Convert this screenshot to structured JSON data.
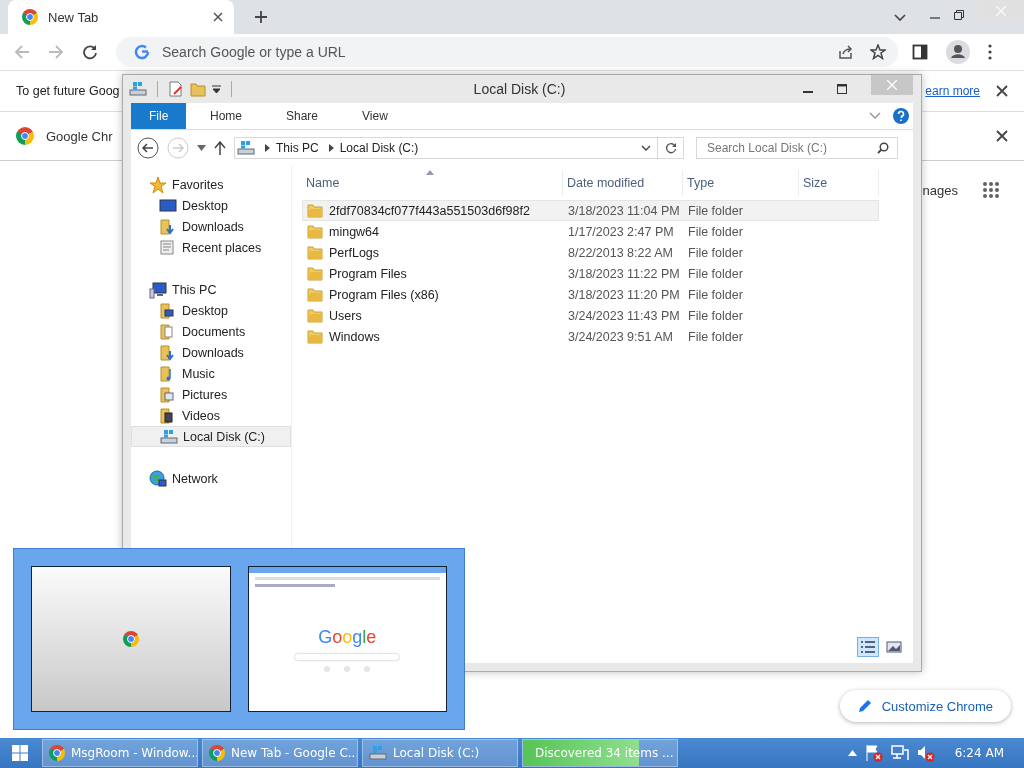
{
  "browser": {
    "tab": {
      "title": "New Tab"
    },
    "omnibox": {
      "placeholder": "Search Google or type a URL"
    },
    "infobar": {
      "text": "To get future Goog",
      "link": "earn more"
    },
    "promo": {
      "text": "Google Chr"
    },
    "ntp_link": "nages",
    "customize_button": "Customize Chrome"
  },
  "explorer": {
    "title": "Local Disk (C:)",
    "ribbon_tabs": [
      {
        "label": "File",
        "kind": "backstage"
      },
      {
        "label": "Home",
        "kind": "tab"
      },
      {
        "label": "Share",
        "kind": "tab"
      },
      {
        "label": "View",
        "kind": "tab"
      }
    ],
    "breadcrumb": [
      "This PC",
      "Local Disk (C:)"
    ],
    "search": {
      "placeholder": "Search Local Disk (C:)"
    },
    "nav": [
      {
        "label": "Favorites",
        "kind": "star",
        "selected": false,
        "children": [
          {
            "label": "Desktop",
            "kind": "desktop",
            "selected": false
          },
          {
            "label": "Downloads",
            "kind": "downloads",
            "selected": false
          },
          {
            "label": "Recent places",
            "kind": "recent",
            "selected": false
          }
        ]
      },
      {
        "label": "This PC",
        "kind": "pc",
        "selected": false,
        "children": [
          {
            "label": "Desktop",
            "kind": "desktop-folder",
            "selected": false
          },
          {
            "label": "Documents",
            "kind": "documents",
            "selected": false
          },
          {
            "label": "Downloads",
            "kind": "downloads",
            "selected": false
          },
          {
            "label": "Music",
            "kind": "music",
            "selected": false
          },
          {
            "label": "Pictures",
            "kind": "pictures",
            "selected": false
          },
          {
            "label": "Videos",
            "kind": "videos",
            "selected": false
          },
          {
            "label": "Local Disk (C:)",
            "kind": "drive",
            "selected": true
          }
        ]
      },
      {
        "label": "Network",
        "kind": "network",
        "selected": false
      }
    ],
    "columns": [
      "Name",
      "Date modified",
      "Type",
      "Size"
    ],
    "rows": [
      {
        "name": "2fdf70834cf077f443a551503d6f98f2",
        "date": "3/18/2023 11:04 PM",
        "type": "File folder",
        "selected": true
      },
      {
        "name": "mingw64",
        "date": "1/17/2023 2:47 PM",
        "type": "File folder",
        "selected": false
      },
      {
        "name": "PerfLogs",
        "date": "8/22/2013 8:22 AM",
        "type": "File folder",
        "selected": false
      },
      {
        "name": "Program Files",
        "date": "3/18/2023 11:22 PM",
        "type": "File folder",
        "selected": false
      },
      {
        "name": "Program Files (x86)",
        "date": "3/18/2023 11:20 PM",
        "type": "File folder",
        "selected": false
      },
      {
        "name": "Users",
        "date": "3/24/2023 11:43 PM",
        "type": "File folder",
        "selected": false
      },
      {
        "name": "Windows",
        "date": "3/24/2023 9:51 AM",
        "type": "File folder",
        "selected": false
      }
    ],
    "view_buttons": [
      {
        "kind": "details",
        "selected": true
      },
      {
        "kind": "thumbnails",
        "selected": false
      }
    ]
  },
  "switcher": {
    "previews": [
      {
        "kind": "loading"
      },
      {
        "kind": "page",
        "logo": "Google"
      }
    ]
  },
  "taskbar": {
    "buttons": [
      {
        "label": "MsgRoom - Window...",
        "kind": "chrome"
      },
      {
        "label": "New Tab - Google C...",
        "kind": "chrome"
      },
      {
        "label": "Local Disk (C:)",
        "kind": "explorer"
      },
      {
        "label": "Discovered 34 items ...",
        "kind": "progress",
        "level": 0.75
      }
    ],
    "clock": "6:24 AM"
  }
}
